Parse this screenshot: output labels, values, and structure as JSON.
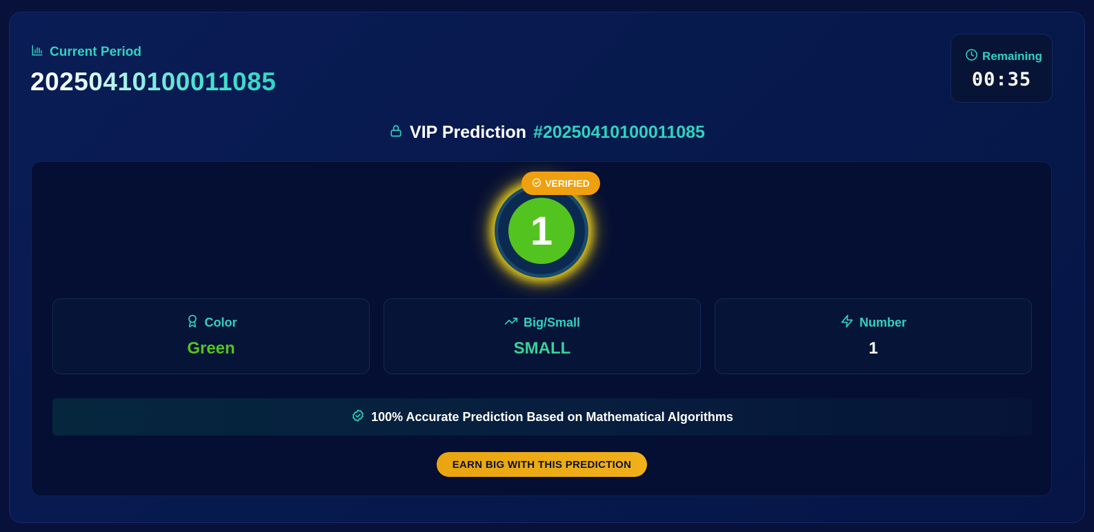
{
  "header": {
    "period_label": "Current Period",
    "period_number": "20250410100011085",
    "icons": {
      "period": "bar-chart-icon"
    }
  },
  "timer": {
    "label": "Remaining",
    "value": "00:35",
    "icon": "clock-icon"
  },
  "vip": {
    "title": "VIP Prediction",
    "hash": "#20250410100011085",
    "icon": "lock-icon"
  },
  "prediction": {
    "badge": "VERIFIED",
    "number": "1",
    "ball_color": "#53c41f",
    "glow_color": "#e5c819"
  },
  "stats": [
    {
      "label": "Color",
      "value": "Green",
      "icon": "award-icon",
      "value_color": "#53c41f"
    },
    {
      "label": "Big/Small",
      "value": "SMALL",
      "icon": "trending-up-icon",
      "value_color": "#37d39a"
    },
    {
      "label": "Number",
      "value": "1",
      "icon": "lightning-icon",
      "value_color": "#ffffff"
    }
  ],
  "accuracy": {
    "text": "100% Accurate Prediction Based on Mathematical Algorithms",
    "icon": "verified-check-icon"
  },
  "cta": {
    "label": "EARN BIG WITH THIS PREDICTION"
  },
  "colors": {
    "accent": "#2fd3c0",
    "gold": "#f0a00e",
    "background": "#07113a"
  }
}
